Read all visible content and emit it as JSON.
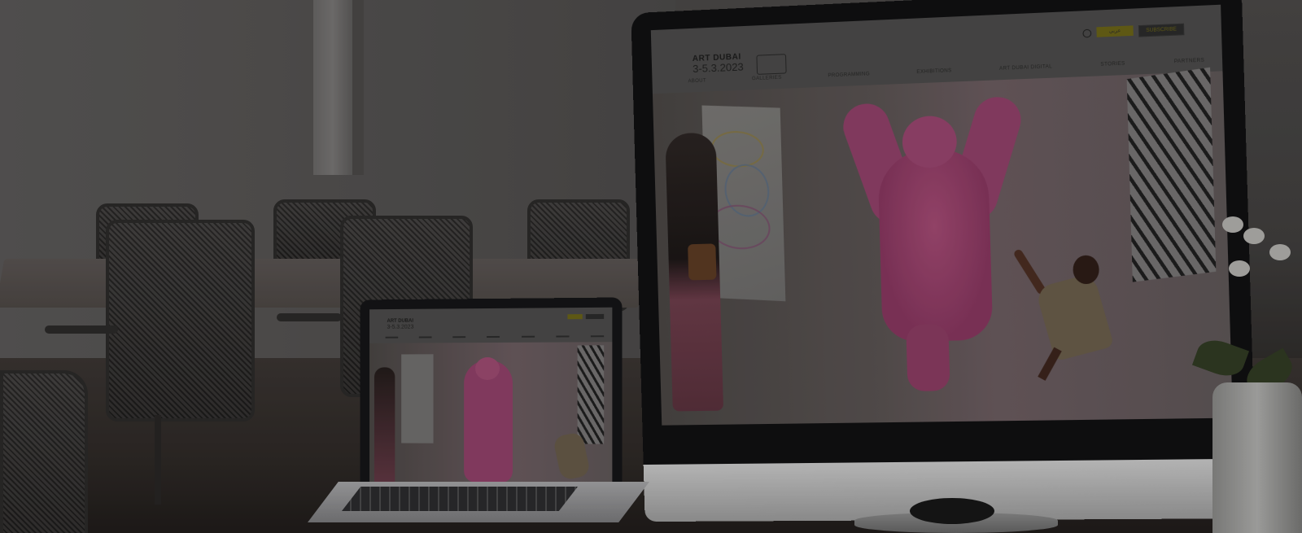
{
  "scene": {
    "description_colors": {
      "room": "#4a4847",
      "bear": "#93406a",
      "accent": "#6b6414"
    }
  },
  "monitor_site": {
    "logo": "ART DUBAI",
    "date": "3-5.3.2023",
    "lang_button": "عربي",
    "subscribe_button": "SUBSCRIBE",
    "nav": [
      "ABOUT",
      "GALLERIES",
      "PROGRAMMING",
      "EXHIBITIONS",
      "ART DUBAI DIGITAL",
      "STORIES",
      "PARTNERS"
    ]
  },
  "laptop_site": {
    "logo": "ART DUBAI",
    "date": "3-5.3.2023"
  }
}
